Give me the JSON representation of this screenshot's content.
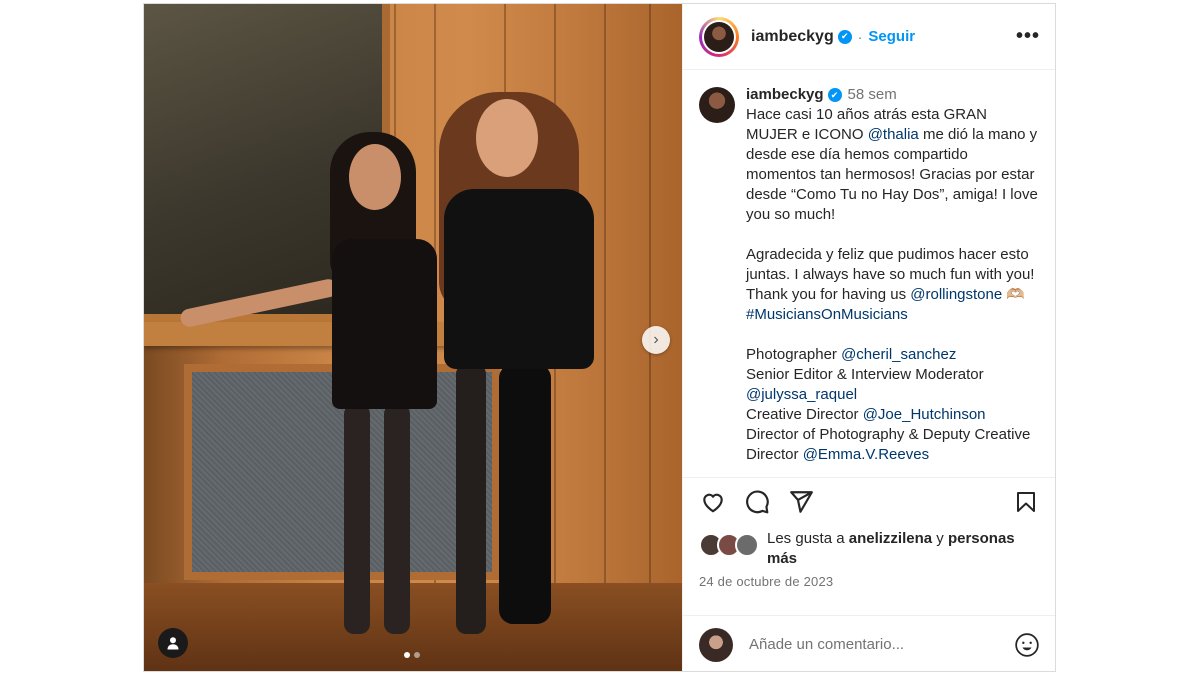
{
  "header": {
    "username": "iambeckyg",
    "verified_mark": "✔",
    "separator": "·",
    "follow_label": "Seguir",
    "more_label": "•••"
  },
  "photo": {
    "next_arrow": "›",
    "slide_count": 2,
    "active_slide": 1
  },
  "caption": {
    "username": "iambeckyg",
    "verified_mark": "✔",
    "time": "58 sem",
    "p1_a": "Hace casi 10 años atrás esta GRAN MUJER e ICONO ",
    "p1_mention": "@thalia",
    "p1_b": " me dió la mano y desde ese día hemos compartido momentos tan hermosos! Gracias por estar desde “Como Tu no Hay Dos”, amiga! I love you so much!",
    "p2_a": "Agradecida y feliz que pudimos hacer esto juntas. I always have so much fun with you! Thank you for having us ",
    "p2_mention": "@rollingstone",
    "p2_emoji": " 🫶🏼",
    "p2_hashtag": "#MusiciansOnMusicians",
    "credit1_role": "Photographer ",
    "credit1_mention": "@cheril_sanchez",
    "credit2_role": "Senior Editor & Interview Moderator",
    "credit2_mention": "@julyssa_raquel",
    "credit3_role": "Creative Director ",
    "credit3_mention": "@Joe_Hutchinson",
    "credit4_role": "Director of Photography & Deputy Creative Director ",
    "credit4_mention": "@Emma.V.Reeves"
  },
  "likes": {
    "prefix": "Les gusta a ",
    "user": "anelizzilena",
    "connector": " y ",
    "suffix": "personas más"
  },
  "date": "24 de octubre de 2023",
  "comment": {
    "placeholder": "Añade un comentario..."
  }
}
